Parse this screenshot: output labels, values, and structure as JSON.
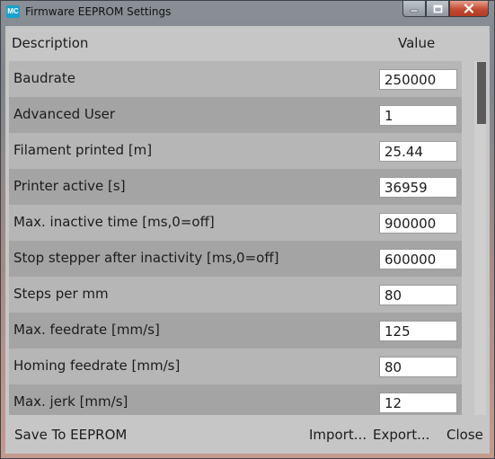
{
  "window": {
    "title": "Firmware EEPROM Settings",
    "app_icon_text": "MC",
    "controls": {
      "minimize_icon": "minimize-icon",
      "maximize_icon": "maximize-icon",
      "close_icon": "close-icon"
    }
  },
  "table": {
    "headers": {
      "description": "Description",
      "value": "Value"
    },
    "rows": [
      {
        "label": "Baudrate",
        "value": "250000"
      },
      {
        "label": "Advanced User",
        "value": "1"
      },
      {
        "label": "Filament printed [m]",
        "value": "25.44"
      },
      {
        "label": "Printer active [s]",
        "value": "36959"
      },
      {
        "label": "Max. inactive time [ms,0=off]",
        "value": "900000"
      },
      {
        "label": "Stop stepper after inactivity [ms,0=off]",
        "value": "600000"
      },
      {
        "label": "Steps per mm",
        "value": "80"
      },
      {
        "label": "Max. feedrate [mm/s]",
        "value": "125"
      },
      {
        "label": "Homing feedrate [mm/s]",
        "value": "80"
      },
      {
        "label": "Max. jerk [mm/s]",
        "value": "12"
      }
    ]
  },
  "footer": {
    "save_label": "Save To EEPROM",
    "import_label": "Import...",
    "export_label": "Export...",
    "close_label": "Close"
  },
  "colors": {
    "row_light": "#b6b6b6",
    "row_dark": "#a4a4a4",
    "panel": "#c6c6c6",
    "scroll_thumb": "#5a5a5a",
    "icon_accent": "#16a2cc",
    "close_button": "#c44b33"
  }
}
